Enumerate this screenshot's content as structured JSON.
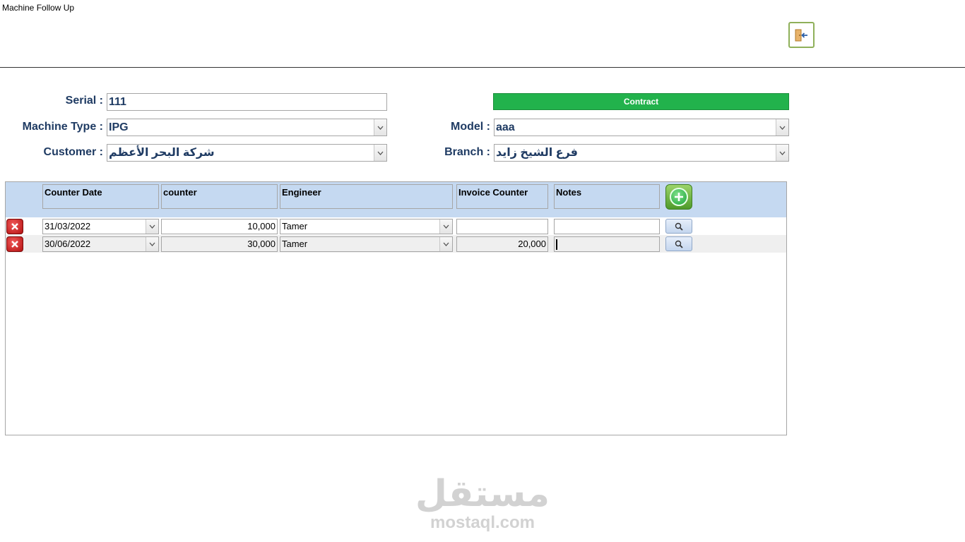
{
  "window": {
    "title": "Machine Follow Up"
  },
  "header": {
    "exit_icon": "exit-door-icon"
  },
  "form": {
    "serial_label": "Serial :",
    "serial_value": "111",
    "contract_label": "Contract",
    "machine_type_label": "Machine Type :",
    "machine_type_value": "IPG",
    "model_label": "Model :",
    "model_value": "aaa",
    "customer_label": "Customer :",
    "customer_value": "شركة البحر الأعظم",
    "branch_label": "Branch :",
    "branch_value": "فرع الشيخ زايد"
  },
  "grid": {
    "columns": [
      "Counter Date",
      "counter",
      "Engineer",
      "Invoice Counter",
      "Notes"
    ],
    "rows": [
      {
        "counter_date": "31/03/2022",
        "counter": "10,000",
        "engineer": "Tamer",
        "invoice_counter": "",
        "notes": ""
      },
      {
        "counter_date": "30/06/2022",
        "counter": "30,000",
        "engineer": "Tamer",
        "invoice_counter": "20,000",
        "notes": ""
      }
    ]
  },
  "colors": {
    "contract_green": "#22b24c",
    "header_blue": "#c5d9f1",
    "label_navy": "#1f3b63"
  },
  "watermark": {
    "arabic": "مستقل",
    "latin": "mostaql.com"
  }
}
